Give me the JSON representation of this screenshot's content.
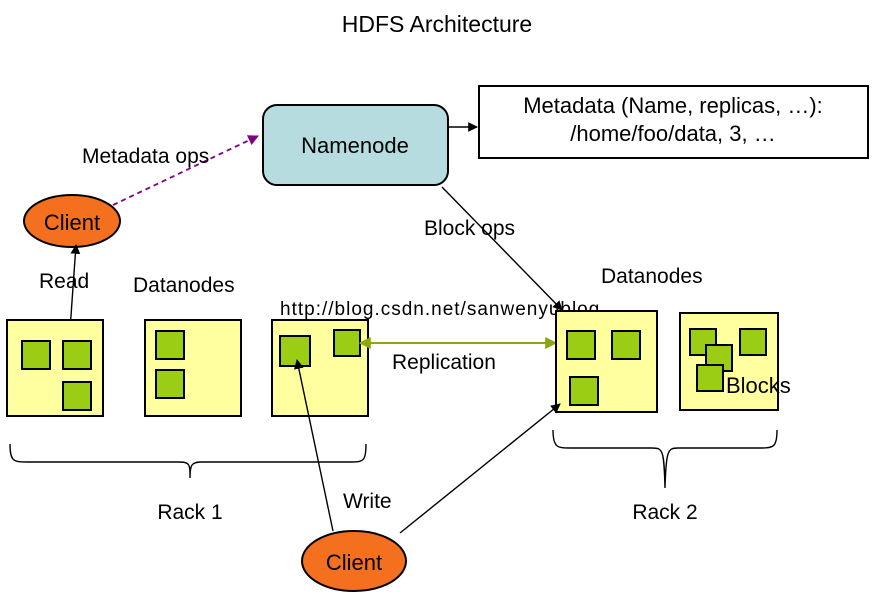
{
  "title": "HDFS Architecture",
  "nodes": {
    "namenode": {
      "label": "Namenode",
      "color": "#b6dcdf"
    },
    "metadata": {
      "line1": "Metadata (Name, replicas, …):",
      "line2": "/home/foo/data, 3, …",
      "color": "#ffffff"
    },
    "client_top": {
      "label": "Client",
      "color": "#f4701e"
    },
    "client_bottom": {
      "label": "Client",
      "color": "#f4701e"
    }
  },
  "labels": {
    "metadata_ops": "Metadata ops",
    "block_ops": "Block ops",
    "replication": "Replication",
    "read": "Read",
    "write": "Write",
    "datanodes_left": "Datanodes",
    "datanodes_right": "Datanodes",
    "blocks": "Blocks",
    "rack1": "Rack 1",
    "rack2": "Rack 2"
  },
  "colors": {
    "datanode_fill": "#ffffa0",
    "block_fill": "#9acd14",
    "namenode_fill": "#b6dcdf",
    "client_fill": "#f4701e",
    "metadata_ops_arrow": "#800080",
    "replication_arrow": "#8aa80a",
    "outline": "#000000"
  },
  "watermark": "http://blog.csdn.net/sanwenyublog",
  "racks": [
    {
      "name": "Rack 1",
      "datanodes": [
        {
          "blocks": 3
        },
        {
          "blocks": 2
        },
        {
          "blocks": 2
        }
      ]
    },
    {
      "name": "Rack 2",
      "datanodes": [
        {
          "blocks": 3
        },
        {
          "blocks": 4
        }
      ]
    }
  ]
}
